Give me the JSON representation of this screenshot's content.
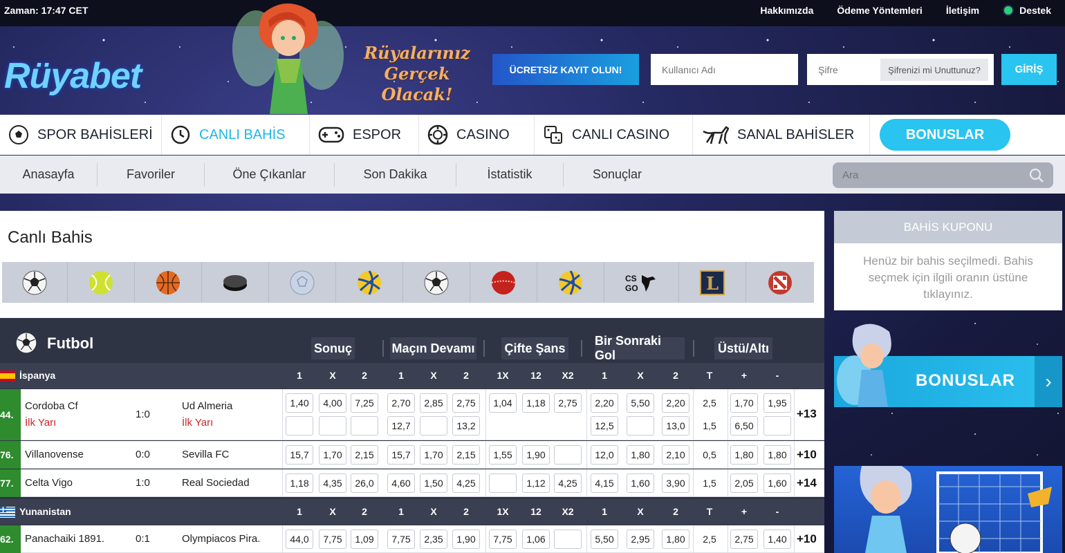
{
  "topbar": {
    "time": "Zaman: 17:47 CET",
    "links": [
      "Hakkımızda",
      "Ödeme Yöntemleri",
      "İletişim"
    ],
    "support": "Destek"
  },
  "header": {
    "logo": "Rüyabet",
    "slogan_line1": "Rüyalarınız",
    "slogan_line2": "Gerçek Olacak!",
    "register": "ÜCRETSİZ KAYIT OLUN!",
    "username_placeholder": "Kullanıcı Adı",
    "password_placeholder": "Şifre",
    "forgot": "Şifrenizi mi Unuttunuz?",
    "login": "GİRİŞ"
  },
  "mainnav": [
    {
      "label": "SPOR BAHİSLERİ",
      "icon": "soccer-ball-icon"
    },
    {
      "label": "CANLI BAHİS",
      "icon": "clock-icon"
    },
    {
      "label": "ESPOR",
      "icon": "gamepad-icon"
    },
    {
      "label": "CASINO",
      "icon": "chip-icon"
    },
    {
      "label": "CANLI CASINO",
      "icon": "dice-icon"
    },
    {
      "label": "SANAL BAHİSLER",
      "icon": "greyhound-icon"
    }
  ],
  "bonus_button": "BONUSLAR",
  "subnav": [
    "Anasayfa",
    "Favoriler",
    "Öne Çıkanlar",
    "Son Dakika",
    "İstatistik",
    "Sonuçlar"
  ],
  "search_placeholder": "Ara",
  "panel": {
    "title": "Canlı Bahis",
    "sport_icons": [
      "soccer-ball-icon",
      "tennis-ball-icon",
      "basketball-icon",
      "hockey-puck-icon",
      "handball-icon",
      "volleyball-icon",
      "soccer-ball-icon",
      "cricket-ball-icon",
      "volleyball-icon",
      "csgo-icon",
      "lol-icon",
      "dota-icon"
    ],
    "csgo_label": "CS GO",
    "lol_label": "L"
  },
  "futbol": {
    "title": "Futbol",
    "markets": [
      "Sonuç",
      "Maçın Devamı",
      "Çifte Şans",
      "Bir Sonraki Gol",
      "Üstü/Altı"
    ],
    "columns": [
      "1",
      "X",
      "2",
      "1",
      "X",
      "2",
      "1X",
      "12",
      "X2",
      "1",
      "X",
      "2",
      "T",
      "+",
      "-"
    ]
  },
  "leagues": [
    {
      "name": "İspanya",
      "matches": [
        {
          "num": "44.",
          "home": "Cordoba Cf",
          "away": "Ud Almeria",
          "score": "1:0",
          "half": "İlk Yarı",
          "line1": [
            "1,40",
            "4,00",
            "7,25",
            "2,70",
            "2,85",
            "2,75",
            "1,04",
            "1,18",
            "2,75",
            "2,20",
            "5,50",
            "2,20",
            "2,5",
            "1,70",
            "1,95"
          ],
          "line2": [
            "",
            "",
            "",
            "12,7",
            "",
            "13,2",
            null,
            null,
            null,
            "12,5",
            "",
            "13,0",
            "1,5",
            "6,50",
            ""
          ],
          "more": "+13"
        },
        {
          "num": "76.",
          "home": "Villanovense",
          "away": "Sevilla FC",
          "score": "0:0",
          "line1": [
            "15,7",
            "1,70",
            "2,15",
            "15,7",
            "1,70",
            "2,15",
            "1,55",
            "1,90",
            "",
            "12,0",
            "1,80",
            "2,10",
            "0,5",
            "1,80",
            "1,80"
          ],
          "more": "+10"
        },
        {
          "num": "77.",
          "home": "Celta Vigo",
          "away": "Real Sociedad",
          "score": "1:0",
          "line1": [
            "1,18",
            "4,35",
            "26,0",
            "4,60",
            "1,50",
            "4,25",
            "",
            "1,12",
            "4,25",
            "4,15",
            "1,60",
            "3,90",
            "1,5",
            "2,05",
            "1,60"
          ],
          "more": "+14"
        }
      ]
    },
    {
      "name": "Yunanistan",
      "matches": [
        {
          "num": "62.",
          "home": "Panachaiki 1891.",
          "away": "Olympiacos Pira.",
          "score": "0:1",
          "line1": [
            "44,0",
            "7,75",
            "1,09",
            "7,75",
            "2,35",
            "1,90",
            "7,75",
            "1,06",
            "",
            "5,50",
            "2,95",
            "1,80",
            "2,5",
            "2,75",
            "1,40"
          ],
          "more": "+10"
        }
      ]
    }
  ],
  "coupon": {
    "title": "BAHİS KUPONU",
    "empty": "Henüz bir bahis seçilmedi. Bahis seçmek için ilgili oranın üstüne tıklayınız."
  },
  "sidebar_bonus": "BONUSLAR",
  "colors": {
    "accent": "#29c4ef",
    "dark": "#2f3445",
    "live": "#2e8b2e",
    "red": "#d12323"
  }
}
